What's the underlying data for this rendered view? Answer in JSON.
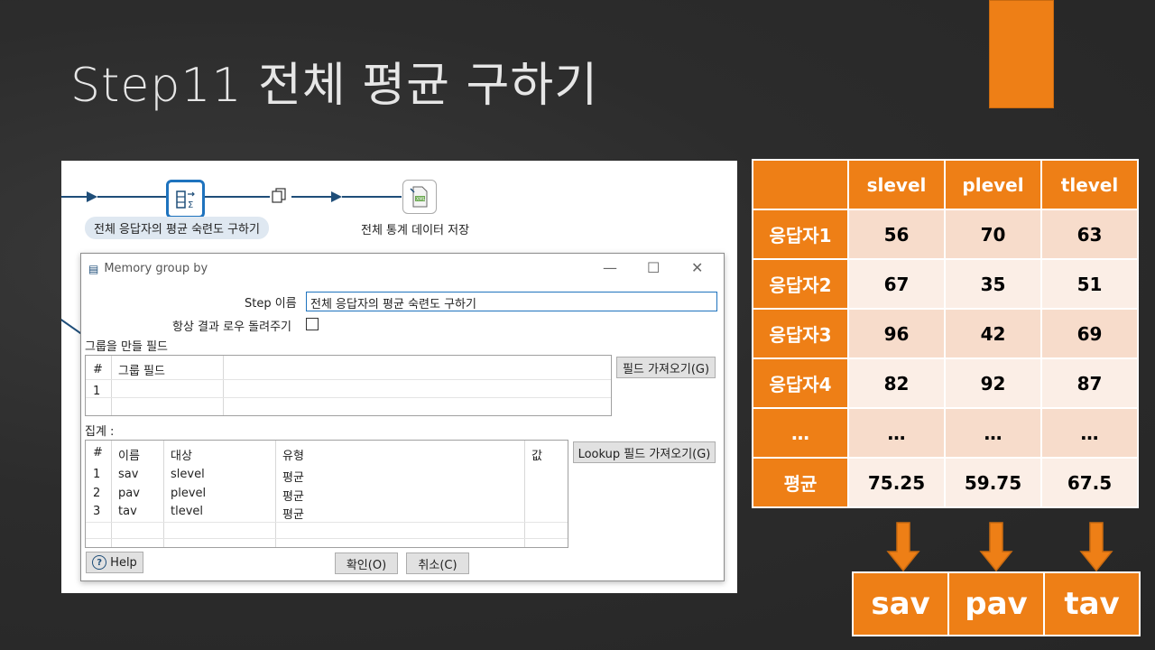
{
  "slide": {
    "title": "Step11 전체 평균 구하기"
  },
  "flow": {
    "step1_label": "전체 응답자의 평균 숙련도 구하기",
    "step2_label": "전체 통계 데이터 저장"
  },
  "dialog": {
    "title": "Memory group by",
    "step_name_label": "Step 이름",
    "step_name_value": "전체 응답자의 평균 숙련도 구하기",
    "always_return_label": "항상 결과 로우 돌려주기",
    "group_fields_label": "그룹을 만들 필드",
    "group_table": {
      "headers": [
        "#",
        "그룹 필드"
      ],
      "rows": [
        [
          "1",
          ""
        ]
      ]
    },
    "get_fields_button": "필드 가져오기(G)",
    "aggregates_label": "집계 :",
    "agg_table": {
      "headers": [
        "#",
        "이름",
        "대상",
        "유형",
        "값"
      ],
      "rows": [
        [
          "1",
          "sav",
          "slevel",
          "평균",
          ""
        ],
        [
          "2",
          "pav",
          "plevel",
          "평균",
          ""
        ],
        [
          "3",
          "tav",
          "tlevel",
          "평균",
          ""
        ]
      ]
    },
    "lookup_button": "Lookup 필드 가져오기(G)",
    "help_button": "Help",
    "ok_button": "확인(O)",
    "cancel_button": "취소(C)",
    "window_controls": {
      "minimize": "—",
      "maximize": "☐",
      "close": "✕"
    }
  },
  "score_table": {
    "headers": [
      "",
      "slevel",
      "plevel",
      "tlevel"
    ],
    "rows": [
      [
        "응답자1",
        "56",
        "70",
        "63"
      ],
      [
        "응답자2",
        "67",
        "35",
        "51"
      ],
      [
        "응답자3",
        "96",
        "42",
        "69"
      ],
      [
        "응답자4",
        "82",
        "92",
        "87"
      ],
      [
        "…",
        "…",
        "…",
        "…"
      ],
      [
        "평균",
        "75.25",
        "59.75",
        "67.5"
      ]
    ]
  },
  "results": [
    "sav",
    "pav",
    "tav"
  ],
  "colors": {
    "accent": "#ee7f16",
    "row_dark": "#f7dccb",
    "row_light": "#fbeee6",
    "flow": "#1f4e79"
  }
}
